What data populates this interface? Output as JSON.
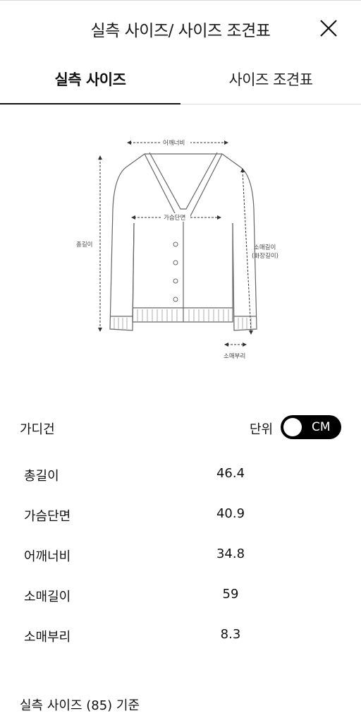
{
  "header": {
    "title": "실측 사이즈/ 사이즈 조견표",
    "close_icon": "close-icon"
  },
  "tabs": [
    {
      "label": "실측 사이즈",
      "active": true
    },
    {
      "label": "사이즈 조견표",
      "active": false
    }
  ],
  "diagram": {
    "labels": {
      "shoulder": "어깨너비",
      "chest": "가슴단면",
      "total_length": "총길이",
      "sleeve_length_1": "소매길이",
      "sleeve_length_2": "(화장길이)",
      "cuff": "소매부리"
    }
  },
  "product": {
    "name": "가디건",
    "unit_label": "단위",
    "unit_value": "CM",
    "unit_toggle_on": true
  },
  "measurements": [
    {
      "label": "총길이",
      "value": "46.4"
    },
    {
      "label": "가슴단면",
      "value": "40.9"
    },
    {
      "label": "어깨너비",
      "value": "34.8"
    },
    {
      "label": "소매길이",
      "value": "59"
    },
    {
      "label": "소매부리",
      "value": "8.3"
    }
  ],
  "footnote": "실측 사이즈 (85) 기준",
  "colors": {
    "accent": "#000000",
    "divider": "#e2e2e2"
  }
}
